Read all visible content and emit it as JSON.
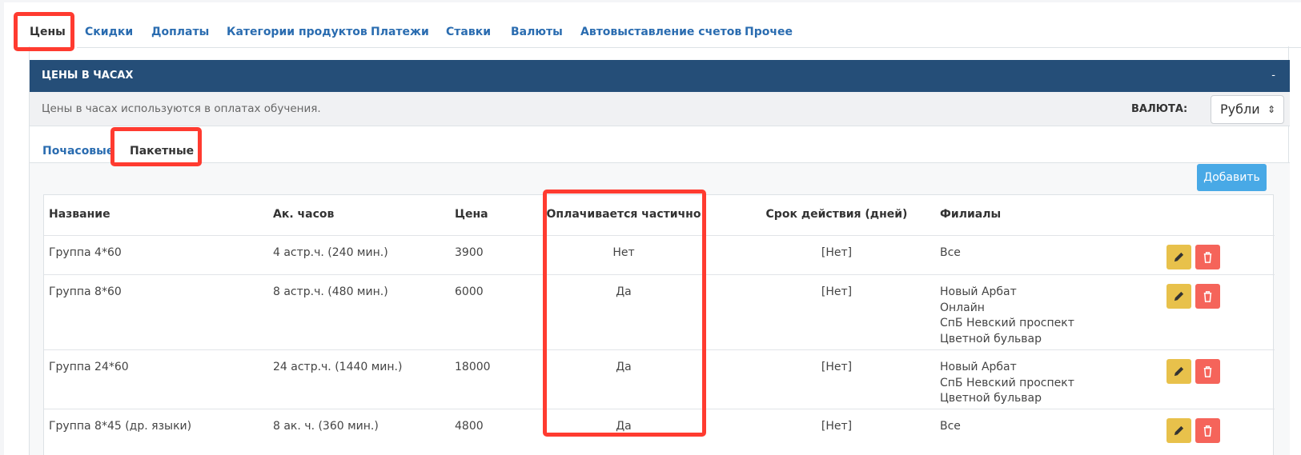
{
  "top_tabs": [
    {
      "label": "Цены",
      "active": true
    },
    {
      "label": "Скидки"
    },
    {
      "label": "Доплаты"
    },
    {
      "label": "Категории продуктов"
    },
    {
      "label": "Платежи"
    },
    {
      "label": "Ставки"
    },
    {
      "label": "Валюты"
    },
    {
      "label": "Автовыставление счетов"
    },
    {
      "label": "Прочее"
    }
  ],
  "panel": {
    "title": "ЦЕНЫ В ЧАСАХ",
    "collapse": "-",
    "info": "Цены в часах используются в оплатах обучения.",
    "currency_label": "ВАЛЮТА:",
    "currency_value": "Рубли"
  },
  "sub_tabs": [
    {
      "label": "Почасовые"
    },
    {
      "label": "Пакетные",
      "active": true
    }
  ],
  "add_label": "Добавить",
  "table": {
    "headers": [
      "Название",
      "Ак. часов",
      "Цена",
      "Оплачивается частично",
      "Срок действия (дней)",
      "Филиалы"
    ],
    "rows": [
      {
        "name": "Группа 4*60",
        "hours": "4 астр.ч. (240 мин.)",
        "price": "3900",
        "partial": "Нет",
        "term": "[Нет]",
        "branches": [
          "Все"
        ]
      },
      {
        "name": "Группа 8*60",
        "hours": "8 астр.ч. (480 мин.)",
        "price": "6000",
        "partial": "Да",
        "term": "[Нет]",
        "branches": [
          "Новый Арбат",
          "Онлайн",
          "СпБ Невский проспект",
          "Цветной бульвар"
        ]
      },
      {
        "name": "Группа 24*60",
        "hours": "24 астр.ч. (1440 мин.)",
        "price": "18000",
        "partial": "Да",
        "term": "[Нет]",
        "branches": [
          "Новый Арбат",
          "СпБ Невский проспект",
          "Цветной бульвар"
        ]
      },
      {
        "name": "Группа 8*45 (др. языки)",
        "hours": "8 ак. ч. (360 мин.)",
        "price": "4800",
        "partial": "Да",
        "term": "[Нет]",
        "branches": [
          "Все"
        ]
      }
    ]
  },
  "colors": {
    "header_bg": "#254e78",
    "link": "#2a6cb0",
    "highlight": "#ff3b30",
    "add_btn": "#48a9e6",
    "edit_btn": "#e8c14b",
    "delete_btn": "#f5645a"
  }
}
